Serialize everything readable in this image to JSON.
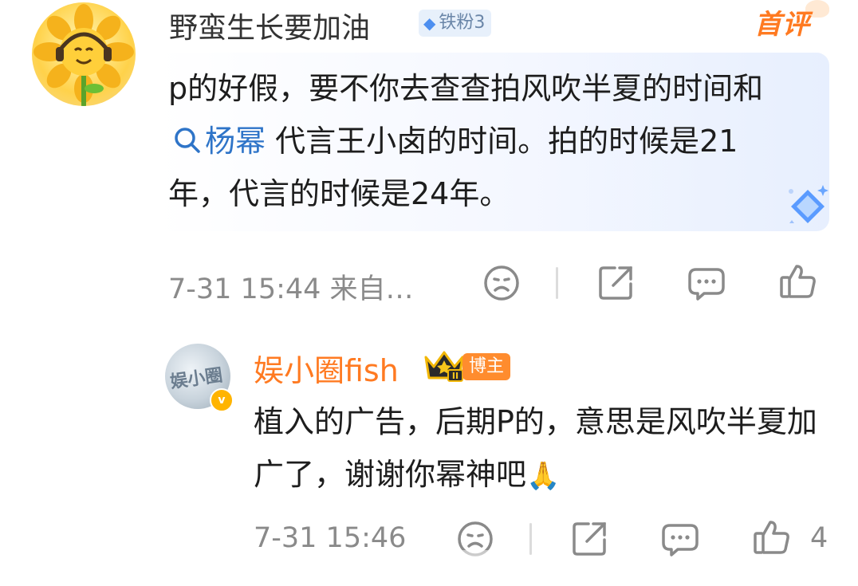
{
  "comment1": {
    "username": "野蛮生长要加油",
    "fan_badge": "铁粉3",
    "first_tag": "首评",
    "text_before": "p的好假，要不你去查查拍风吹半夏的时间和",
    "topic": "杨幂",
    "text_after": " 代言王小卤的时间。拍的时候是21年，代言的时候是24年。",
    "meta": "7-31 15:44 来自…",
    "icons": [
      "dislike-face-icon",
      "share-icon",
      "comment-icon",
      "thumbs-up-icon"
    ]
  },
  "comment2": {
    "username": "娱小圈fish",
    "avatar_text": "娱小圈",
    "verified_badge": "v",
    "role_badge": "博主",
    "text": "植入的广告，后期P的，意思是风吹半夏加广了，谢谢你幂神吧",
    "emoji": "🙏",
    "meta": "7-31 15:46",
    "like_count": "4",
    "icons": [
      "dislike-face-icon",
      "share-icon",
      "comment-icon",
      "thumbs-up-icon"
    ]
  },
  "colors": {
    "accent_orange": "#ff7a21",
    "link_blue": "#2e74c8",
    "meta_gray": "#8a8a8a"
  }
}
